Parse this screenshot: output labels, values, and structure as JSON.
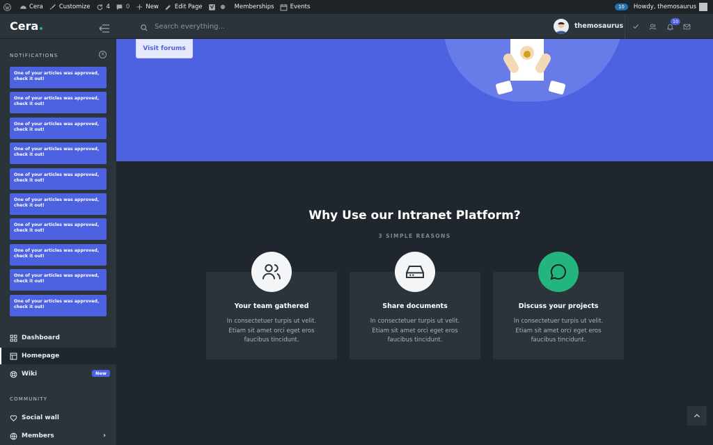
{
  "adminbar": {
    "site": "Cera",
    "customize": "Customize",
    "updates": "4",
    "comments": "0",
    "new": "New",
    "edit_page": "Edit Page",
    "memberships": "Memberships",
    "events": "Events",
    "notif_count": "10",
    "howdy": "Howdy, themosaurus"
  },
  "header": {
    "logo": "Cera",
    "search_placeholder": "Search everything...",
    "username": "themosaurus",
    "notif_badge": "10"
  },
  "sidebar": {
    "notifications_title": "NOTIFICATIONS",
    "notifications": [
      "One of your articles was approved, check it out!",
      "One of your articles was approved, check it out!",
      "One of your articles was approved, check it out!",
      "One of your articles was approved, check it out!",
      "One of your articles was approved, check it out!",
      "One of your articles was approved, check it out!",
      "One of your articles was approved, check it out!",
      "One of your articles was approved, check it out!",
      "One of your articles was approved, check it out!",
      "One of your articles was approved, check it out!"
    ],
    "nav": {
      "dashboard": "Dashboard",
      "homepage": "Homepage",
      "wiki": "Wiki",
      "wiki_badge": "New",
      "community_title": "COMMUNITY",
      "social_wall": "Social wall",
      "members": "Members"
    }
  },
  "hero": {
    "visit_button": "Visit forums"
  },
  "main": {
    "title": "Why Use our Intranet Platform?",
    "subtitle": "3 SIMPLE REASONS",
    "features": [
      {
        "title": "Your team gathered",
        "desc": "In consectetuer turpis ut velit. Etiam sit amet orci eget eros faucibus tincidunt.",
        "icon": "users-icon"
      },
      {
        "title": "Share documents",
        "desc": "In consectetuer turpis ut velit. Etiam sit amet orci eget eros faucibus tincidunt.",
        "icon": "hard-drive-icon"
      },
      {
        "title": "Discuss your projects",
        "desc": "In consectetuer turpis ut velit. Etiam sit amet orci eget eros faucibus tincidunt.",
        "icon": "message-circle-icon"
      }
    ]
  },
  "colors": {
    "accent": "#4d62e0",
    "green": "#24b47e",
    "sidebar_bg": "#2b333b",
    "main_bg": "#20262d"
  }
}
